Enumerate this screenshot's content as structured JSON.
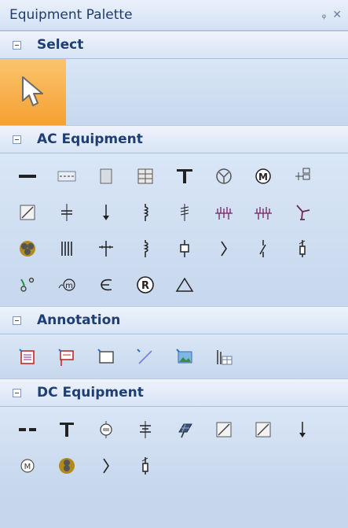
{
  "window": {
    "title": "Equipment Palette",
    "pin_glyph": "ᵩ",
    "close_glyph": "✕"
  },
  "sections": {
    "select": {
      "label": "Select",
      "items": [
        {
          "icon": "pointer-icon"
        }
      ]
    },
    "ac": {
      "label": "AC Equipment"
    },
    "annotation": {
      "label": "Annotation"
    },
    "dc": {
      "label": "DC Equipment"
    }
  },
  "colors": {
    "selected_tile": "#f5a032",
    "header_text": "#1e3e76",
    "accent": "#3c7ad6"
  }
}
